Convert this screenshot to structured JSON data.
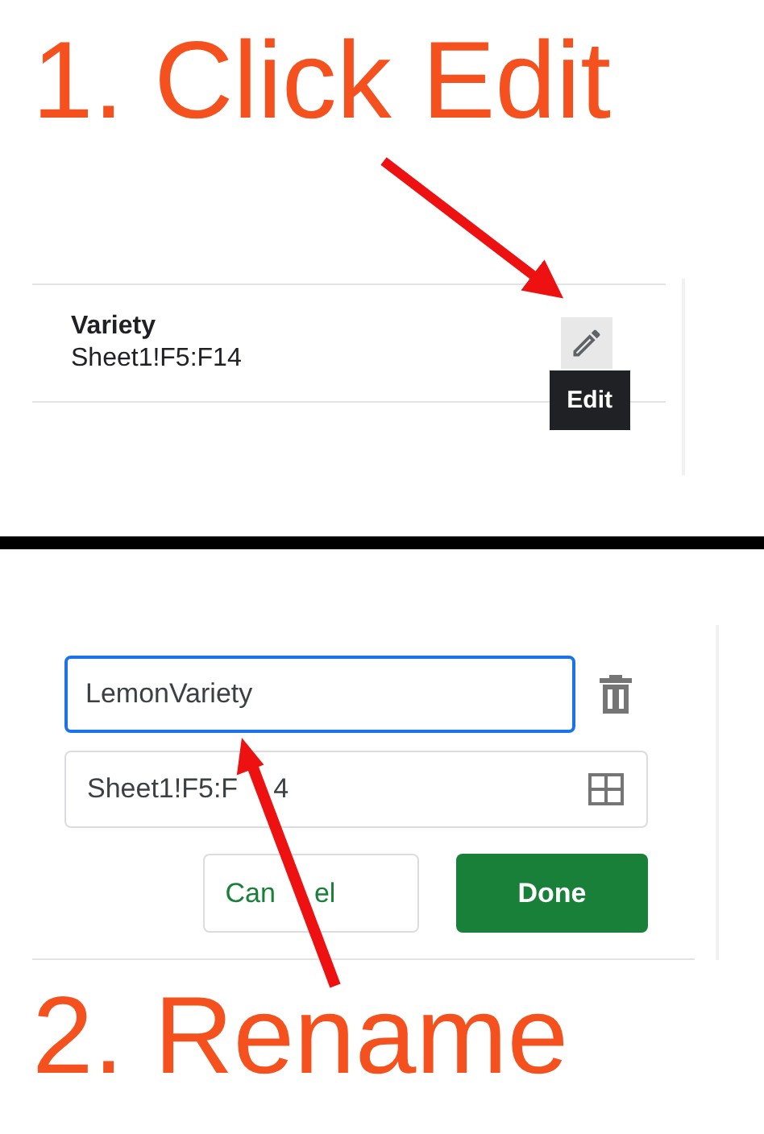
{
  "step_1": {
    "heading": "1. Click Edit",
    "named_range": {
      "name": "Variety",
      "range": "Sheet1!F5:F14"
    },
    "edit_button": {
      "hovered": true,
      "tooltip": "Edit"
    }
  },
  "step_2": {
    "name_field": {
      "value": "LemonVariety",
      "focused": true
    },
    "range_field": {
      "visible_parts": [
        "Sheet1!F5:F",
        "4"
      ]
    },
    "buttons": [
      {
        "label_parts": [
          "Can",
          "el"
        ],
        "kind": "secondary"
      },
      {
        "label_parts": [
          "Done"
        ],
        "kind": "primary"
      }
    ],
    "heading": "2. Rename"
  }
}
